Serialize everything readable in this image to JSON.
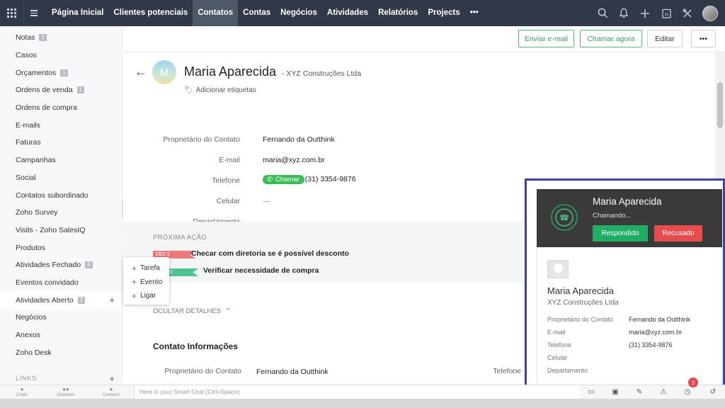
{
  "nav": {
    "items": [
      "Página Inicial",
      "Clientes potenciais",
      "Contatos",
      "Contas",
      "Negócios",
      "Atividades",
      "Relatórios",
      "Projects",
      "•••"
    ],
    "active_index": 2
  },
  "sidebar": {
    "items": [
      {
        "label": "Notas",
        "badge": "1"
      },
      {
        "label": "Casos",
        "badge": ""
      },
      {
        "label": "Orçamentos",
        "badge": "1"
      },
      {
        "label": "Ordens de venda",
        "badge": "1"
      },
      {
        "label": "Ordens de compra",
        "badge": ""
      },
      {
        "label": "E-mails",
        "badge": ""
      },
      {
        "label": "Faturas",
        "badge": ""
      },
      {
        "label": "Campanhas",
        "badge": ""
      },
      {
        "label": "Social",
        "badge": ""
      },
      {
        "label": "Contatos subordinado",
        "badge": ""
      },
      {
        "label": "Zoho Survey",
        "badge": ""
      },
      {
        "label": "Visits - Zoho SalesIQ",
        "badge": ""
      },
      {
        "label": "Produtos",
        "badge": ""
      },
      {
        "label": "Atividades Fechado",
        "badge": "6"
      },
      {
        "label": "Eventos convidado",
        "badge": ""
      },
      {
        "label": "Atividades Aberto",
        "badge": "2"
      },
      {
        "label": "Negócios",
        "badge": ""
      },
      {
        "label": "Anexos",
        "badge": ""
      },
      {
        "label": "Zoho Desk",
        "badge": ""
      }
    ],
    "links_label": "LINKS"
  },
  "popup": {
    "items": [
      "Tarefa",
      "Evento",
      "Ligar"
    ]
  },
  "actions": {
    "send_email": "Enviar e-mail",
    "call_now": "Chamar agora",
    "edit": "Editar",
    "more": "•••"
  },
  "contact": {
    "initial": "M",
    "name": "Maria Aparecida",
    "company": "- XYZ Construções Ltda",
    "add_tags": "Adicionar etiquetas",
    "fields": [
      {
        "label": "Proprietário do Contato",
        "value": "Fernando da Outthink"
      },
      {
        "label": "E-mail",
        "value": "maria@xyz.com.br"
      },
      {
        "label": "Telefone",
        "value": "(31) 3354-9876",
        "pill": "Chamar"
      },
      {
        "label": "Celular",
        "value": "—"
      },
      {
        "label": "Departamento",
        "value": "—"
      }
    ]
  },
  "next_action": {
    "title": "PRÓXIMA AÇÃO",
    "items": [
      {
        "flag": "DEZ 2",
        "text": "Checar com diretoria se é possível desconto"
      },
      {
        "flag": "2, 2020",
        "text": "Verificar necessidade de compra"
      }
    ]
  },
  "details": {
    "hide_label": "OCULTAR DETALHES",
    "section_title": "Contato Informações",
    "row_label": "Proprietário do Contato",
    "row_value": "Fernando da Outthink",
    "row_label_right": "Telefone"
  },
  "call_panel": {
    "name": "Maria Aparecida",
    "status": "Chamando...",
    "accept": "Respondido",
    "reject": "Recusado",
    "card_name": "Maria Aparecida",
    "card_company": "XYZ Construções Ltda",
    "rows": [
      {
        "label": "Proprietário do Contato",
        "value": "Fernando da Outthink"
      },
      {
        "label": "E-mail",
        "value": "maria@xyz.com.br"
      },
      {
        "label": "Telefone",
        "value": "(31) 3354-9876"
      },
      {
        "label": "Celular",
        "value": ""
      },
      {
        "label": "Departamento",
        "value": ""
      }
    ]
  },
  "bottom": {
    "tabs": [
      "Chats",
      "Channels",
      "Contacts"
    ],
    "smartchat_placeholder": "Here is your Smart Chat (Ctrl+Space)",
    "notification_count": "3"
  },
  "colors": {
    "topnav": "#313949",
    "accent_green": "#3dbb57",
    "call_frame": "#3a3fb7",
    "reject_red": "#e74c4c"
  }
}
